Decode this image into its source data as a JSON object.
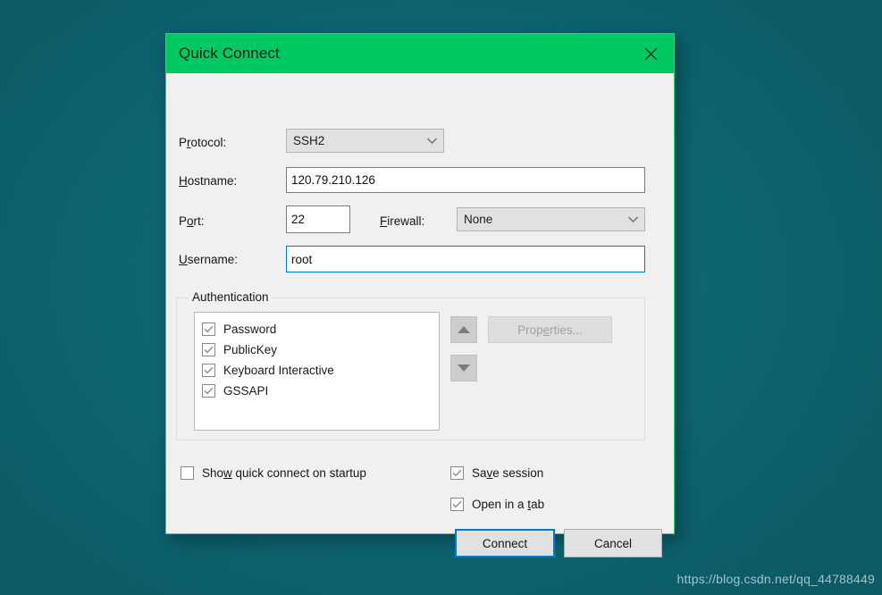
{
  "colors": {
    "desktop_background": "#0d6470",
    "titlebar_green": "#00c963",
    "dialog_background": "#f0f0f0",
    "focus_blue": "#0078d7",
    "watermark_text": "#9fc4c9"
  },
  "dialog": {
    "title": "Quick Connect",
    "close_icon": "close-icon"
  },
  "form": {
    "protocol": {
      "label_pre": "P",
      "label_accel": "r",
      "label_post": "otocol:",
      "value": "SSH2",
      "options": [
        "SSH2"
      ]
    },
    "hostname": {
      "label_pre": "",
      "label_accel": "H",
      "label_post": "ostname:",
      "value": "120.79.210.126",
      "placeholder": ""
    },
    "port": {
      "label_pre": "P",
      "label_accel": "o",
      "label_post": "rt:",
      "value": "22",
      "placeholder": ""
    },
    "firewall": {
      "label_pre": "",
      "label_accel": "F",
      "label_post": "irewall:",
      "value": "None",
      "options": [
        "None"
      ]
    },
    "username": {
      "label_pre": "",
      "label_accel": "U",
      "label_post": "sername:",
      "value": "root",
      "placeholder": ""
    }
  },
  "authentication": {
    "group_title": "Authentication",
    "items": [
      {
        "label": "Password",
        "checked": true
      },
      {
        "label": "PublicKey",
        "checked": true
      },
      {
        "label": "Keyboard Interactive",
        "checked": true
      },
      {
        "label": "GSSAPI",
        "checked": true
      }
    ],
    "move_up_icon": "arrow-up-icon",
    "move_down_icon": "arrow-down-icon",
    "properties_button": {
      "pre": "Prop",
      "accel": "e",
      "post": "rties...",
      "enabled": false
    }
  },
  "options": {
    "show_on_startup": {
      "pre": "Sho",
      "accel": "w",
      "post": " quick connect on startup",
      "checked": false
    },
    "save_session": {
      "pre": "Sa",
      "accel": "v",
      "post": "e session",
      "checked": true
    },
    "open_in_tab": {
      "pre": "Open in a ",
      "accel": "t",
      "post": "ab",
      "checked": true
    }
  },
  "buttons": {
    "connect": "Connect",
    "cancel": "Cancel"
  },
  "watermark": "https://blog.csdn.net/qq_44788449"
}
